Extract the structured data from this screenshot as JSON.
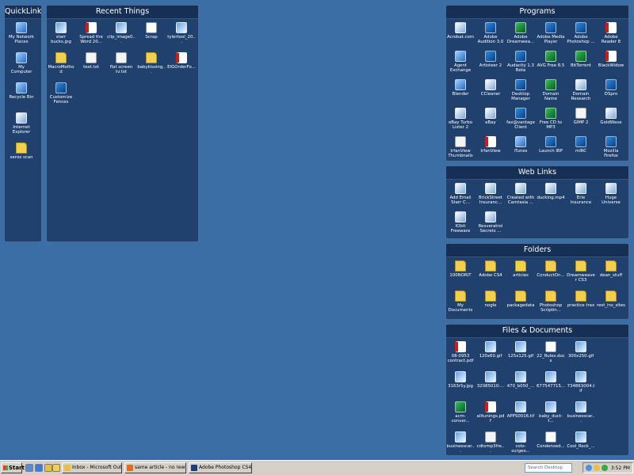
{
  "fences": {
    "quicklinks": {
      "title": "QuickLinks",
      "items": [
        {
          "label": "My Network Places",
          "icon": "network-places-icon",
          "kind": "sys"
        },
        {
          "label": "My Computer",
          "icon": "computer-icon",
          "kind": "sys"
        },
        {
          "label": "Recycle Bin",
          "icon": "recycle-bin-icon",
          "kind": "sys"
        },
        {
          "label": "Internet Explorer",
          "icon": "internet-explorer-icon",
          "kind": "web"
        },
        {
          "label": "xerox scan",
          "icon": "folder-icon",
          "kind": "folder"
        }
      ]
    },
    "recent": {
      "title": "Recent Things",
      "items": [
        {
          "label": "starr bucks.jpg",
          "icon": "image-file-icon",
          "kind": "img"
        },
        {
          "label": "Spread the Word 20...",
          "icon": "pdf-file-icon",
          "kind": "pdf"
        },
        {
          "label": "clip_image0...",
          "icon": "image-file-icon",
          "kind": "img"
        },
        {
          "label": "Scrap",
          "icon": "scrap-icon",
          "kind": "doc"
        },
        {
          "label": "tylertool_20...",
          "icon": "image-file-icon",
          "kind": "img"
        },
        {
          "label": "MacroMethod",
          "icon": "folder-icon",
          "kind": "folder"
        },
        {
          "label": "text.txt",
          "icon": "text-file-icon",
          "kind": "text"
        },
        {
          "label": "flat screen tv.txt",
          "icon": "text-file-icon",
          "kind": "text"
        },
        {
          "label": "babykissing...",
          "icon": "folder-icon",
          "kind": "folder"
        },
        {
          "label": "EIGOrderFo...",
          "icon": "pdf-file-icon",
          "kind": "pdf"
        },
        {
          "label": "Customize Fences",
          "icon": "customize-fences-icon",
          "kind": "app"
        }
      ]
    },
    "programs": {
      "title": "Programs",
      "items": [
        {
          "label": "Acrobat.com",
          "icon": "acrobat-com-icon",
          "kind": "web"
        },
        {
          "label": "Adobe Audition 3.0",
          "icon": "adobe-audition-icon",
          "kind": "app"
        },
        {
          "label": "Adobe Dreamwea...",
          "icon": "dreamweaver-icon",
          "kind": "media"
        },
        {
          "label": "Adobe Media Player",
          "icon": "adobe-media-player-icon",
          "kind": "app"
        },
        {
          "label": "Adobe Photoshop ...",
          "icon": "photoshop-icon",
          "kind": "app"
        },
        {
          "label": "Adobe Reader 8",
          "icon": "adobe-reader-icon",
          "kind": "pdf"
        },
        {
          "label": "Agent Exchange",
          "icon": "agent-exchange-icon",
          "kind": "sys"
        },
        {
          "label": "Artisteer 2",
          "icon": "artisteer-icon",
          "kind": "app"
        },
        {
          "label": "Audacity 1.3 Beta (Unicode)",
          "icon": "audacity-icon",
          "kind": "app"
        },
        {
          "label": "AVG Free 8.5",
          "icon": "avg-icon",
          "kind": "media"
        },
        {
          "label": "BitTorrent",
          "icon": "bittorrent-icon",
          "kind": "media"
        },
        {
          "label": "BlackWidow",
          "icon": "blackwidow-icon",
          "kind": "pdf"
        },
        {
          "label": "Blender",
          "icon": "blender-icon",
          "kind": "sys"
        },
        {
          "label": "CCleaner",
          "icon": "ccleaner-icon",
          "kind": "web"
        },
        {
          "label": "Desktop Manager",
          "icon": "desktop-manager-icon",
          "kind": "app"
        },
        {
          "label": "Domain Name Analyzer v4",
          "icon": "domain-analyzer-icon",
          "kind": "media"
        },
        {
          "label": "Domain Research Tool",
          "icon": "domain-research-icon",
          "kind": "web"
        },
        {
          "label": "DSpro",
          "icon": "dspro-icon",
          "kind": "app"
        },
        {
          "label": "eBay Turbo Lister 2",
          "icon": "turbo-lister-icon",
          "kind": "web"
        },
        {
          "label": "eBay",
          "icon": "ebay-icon",
          "kind": "web"
        },
        {
          "label": "fax@vantage Client",
          "icon": "fax-client-icon",
          "kind": "app"
        },
        {
          "label": "Free CD to MP3 Converter",
          "icon": "cd-mp3-icon",
          "kind": "media"
        },
        {
          "label": "GIMP 2",
          "icon": "gimp-icon",
          "kind": "text"
        },
        {
          "label": "GoldWave",
          "icon": "goldwave-icon",
          "kind": "web"
        },
        {
          "label": "IrfanView Thumbnails",
          "icon": "irfanview-thumbnails-icon",
          "kind": "text"
        },
        {
          "label": "IrfanView",
          "icon": "irfanview-icon",
          "kind": "pdf"
        },
        {
          "label": "iTunes",
          "icon": "itunes-icon",
          "kind": "sys"
        },
        {
          "label": "Launch IBP",
          "icon": "launch-ibp-icon",
          "kind": "app"
        },
        {
          "label": "mIRC",
          "icon": "mirc-icon",
          "kind": "app"
        },
        {
          "label": "Mozilla Firefox",
          "icon": "firefox-icon",
          "kind": "app"
        }
      ]
    },
    "weblinks": {
      "title": "Web Links",
      "items": [
        {
          "label": "Add Email Starr C...",
          "icon": "web-shortcut-icon",
          "kind": "web"
        },
        {
          "label": "BrickStreet Insuranc...",
          "icon": "web-shortcut-icon",
          "kind": "web"
        },
        {
          "label": "Created with Camtasia ...",
          "icon": "web-shortcut-icon",
          "kind": "web"
        },
        {
          "label": "ducking.mp4",
          "icon": "web-shortcut-icon",
          "kind": "web"
        },
        {
          "label": "Erie Insurance Group",
          "icon": "web-shortcut-icon",
          "kind": "web"
        },
        {
          "label": "Huge Universe Church Sou...",
          "icon": "web-shortcut-icon",
          "kind": "web"
        },
        {
          "label": "IObit Freeware",
          "icon": "web-shortcut-icon",
          "kind": "web"
        },
        {
          "label": "Resveratrol Secrets ...",
          "icon": "web-shortcut-icon",
          "kind": "web"
        }
      ]
    },
    "folders": {
      "title": "Folders",
      "items": [
        {
          "label": "100NORIT",
          "icon": "folder-icon",
          "kind": "folder"
        },
        {
          "label": "Adobe CS4",
          "icon": "folder-icon",
          "kind": "folder"
        },
        {
          "label": "articles",
          "icon": "folder-icon",
          "kind": "folder"
        },
        {
          "label": "ConductOn...",
          "icon": "folder-icon",
          "kind": "folder"
        },
        {
          "label": "Dreamweaver CS3",
          "icon": "folder-icon",
          "kind": "folder"
        },
        {
          "label": "dean_stuff",
          "icon": "folder-icon",
          "kind": "folder"
        },
        {
          "label": "My Documents",
          "icon": "my-documents-icon",
          "kind": "folder"
        },
        {
          "label": "nogle",
          "icon": "folder-icon",
          "kind": "folder"
        },
        {
          "label": "packagedata",
          "icon": "folder-icon",
          "kind": "folder"
        },
        {
          "label": "Photoshop Scriptin...",
          "icon": "folder-icon",
          "kind": "folder"
        },
        {
          "label": "practice trax",
          "icon": "folder-icon",
          "kind": "folder"
        },
        {
          "label": "rest_ins_sites",
          "icon": "folder-icon",
          "kind": "folder"
        }
      ]
    },
    "files": {
      "title": "Files & Documents",
      "items": [
        {
          "label": "08-0953 contract.pdf",
          "icon": "pdf-file-icon",
          "kind": "pdf"
        },
        {
          "label": "120x60.gif",
          "icon": "image-file-icon",
          "kind": "img"
        },
        {
          "label": "125x125.gif",
          "icon": "image-file-icon",
          "kind": "img"
        },
        {
          "label": "22_Rules.docx",
          "icon": "word-document-icon",
          "kind": "doc"
        },
        {
          "label": "300x250.gif",
          "icon": "image-file-icon",
          "kind": "img"
        },
        {
          "label": "3163r5y.jpg",
          "icon": "image-file-icon",
          "kind": "img"
        },
        {
          "label": "32085010-...",
          "icon": "image-file-icon",
          "kind": "img"
        },
        {
          "label": "470_b050_...",
          "icon": "image-file-icon",
          "kind": "img"
        },
        {
          "label": "677547715...",
          "icon": "image-file-icon",
          "kind": "img"
        },
        {
          "label": "734863004.tif",
          "icon": "image-file-icon",
          "kind": "img"
        },
        {
          "label": "acm-conver...",
          "icon": "acm-icon",
          "kind": "media"
        },
        {
          "label": "alltunings.pdf",
          "icon": "pdf-file-icon",
          "kind": "pdf"
        },
        {
          "label": "APPS0016.tif",
          "icon": "image-file-icon",
          "kind": "img"
        },
        {
          "label": "baby_duct-t...",
          "icon": "image-file-icon",
          "kind": "img"
        },
        {
          "label": "businesscar...",
          "icon": "image-file-icon",
          "kind": "img"
        },
        {
          "label": "businesscar...",
          "icon": "image-file-icon",
          "kind": "img"
        },
        {
          "label": "cdtomp3fre...",
          "icon": "installer-icon",
          "kind": "text"
        },
        {
          "label": "colo-surgeo...",
          "icon": "image-file-icon",
          "kind": "img"
        },
        {
          "label": "Condensed...",
          "icon": "word-document-icon",
          "kind": "doc"
        },
        {
          "label": "Cool_Rock_...",
          "icon": "image-file-icon",
          "kind": "img"
        }
      ]
    }
  },
  "taskbar": {
    "start_label": "Start",
    "tasks": [
      {
        "label": "Inbox - Microsoft Outlook",
        "icon": "outlook-icon",
        "color": "#e8c040"
      },
      {
        "label": "same article - no rewritin...",
        "icon": "firefox-icon",
        "color": "#e07020"
      },
      {
        "label": "Adobe Photoshop CS4 E...",
        "icon": "photoshop-icon",
        "color": "#1c3f7a"
      }
    ],
    "search_placeholder": "Search Desktop",
    "clock": "3:52 PM"
  },
  "colors": {
    "desktop": "#3a6ea5",
    "fence_bg": "#163058",
    "taskbar": "#d4d0c8"
  }
}
